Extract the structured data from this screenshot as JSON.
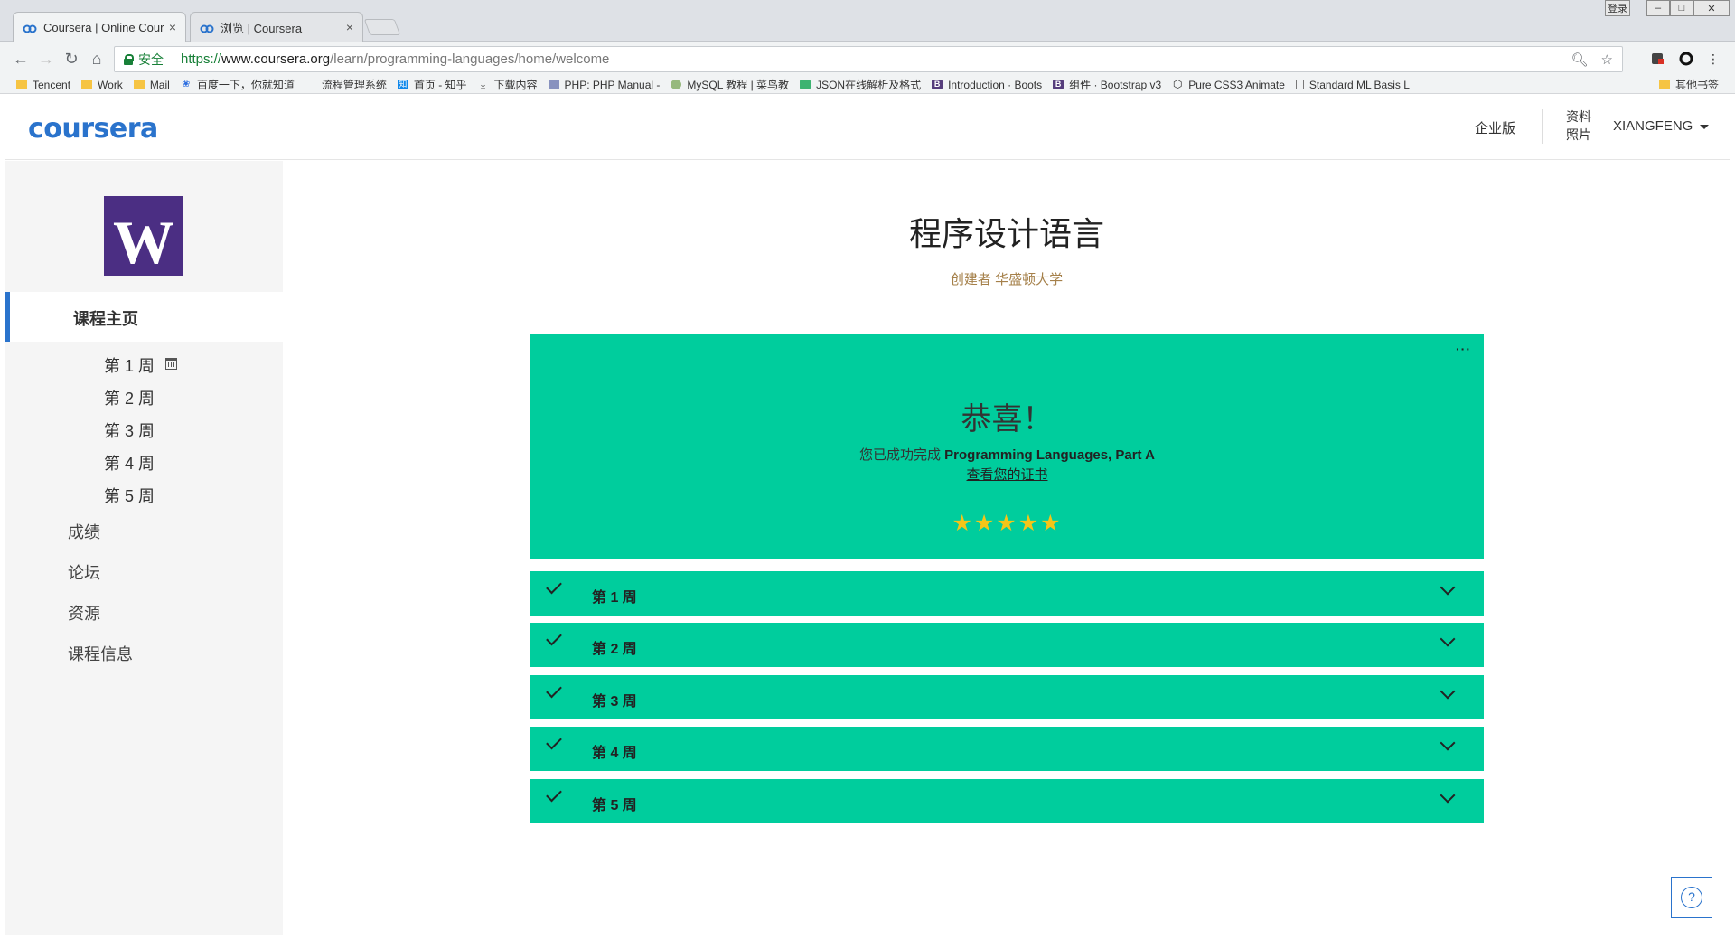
{
  "browser": {
    "tabs": [
      {
        "title": "Coursera | Online Cour",
        "close": "×"
      },
      {
        "title": "浏览 | Coursera",
        "close": "×"
      }
    ],
    "window_controls": [
      "登录",
      "–",
      "□",
      "✕"
    ],
    "nav": {
      "back": "←",
      "forward": "→",
      "reload": "↻",
      "home": "⌂"
    },
    "secure_label": "安全",
    "url": {
      "scheme": "https://",
      "host": "www.coursera.org",
      "path": "/learn/programming-languages/home/welcome"
    },
    "omnibox_icons": [
      "zoom-icon",
      "star-icon"
    ],
    "bookmarks": [
      {
        "label": "Tencent",
        "icon": "folder"
      },
      {
        "label": "Work",
        "icon": "folder"
      },
      {
        "label": "Mail",
        "icon": "folder"
      },
      {
        "label": "百度一下，你就知道",
        "icon": "baidu"
      },
      {
        "label": "流程管理系统",
        "icon": "none"
      },
      {
        "label": "首页 - 知乎",
        "icon": "zhihu"
      },
      {
        "label": "下载内容",
        "icon": "download"
      },
      {
        "label": "PHP: PHP Manual -",
        "icon": "php"
      },
      {
        "label": "MySQL 教程 | 菜鸟教",
        "icon": "runoob"
      },
      {
        "label": "JSON在线解析及格式",
        "icon": "json"
      },
      {
        "label": "Introduction · Boots",
        "icon": "bootstrap"
      },
      {
        "label": "组件 · Bootstrap v3",
        "icon": "bootstrap"
      },
      {
        "label": "Pure CSS3 Animate",
        "icon": "codepen"
      },
      {
        "label": "Standard ML Basis L",
        "icon": "page"
      }
    ],
    "other_bookmarks": "其他书签"
  },
  "site": {
    "logo": "coursera",
    "enterprise": "企业版",
    "profile_line1": "资料",
    "profile_line2": "照片",
    "username": "XIANGFENG"
  },
  "sidebar": {
    "uw_logo_letter": "W",
    "home": "课程主页",
    "weeks": [
      "第 1 周",
      "第 2 周",
      "第 3 周",
      "第 4 周",
      "第 5 周"
    ],
    "links": [
      "成绩",
      "论坛",
      "资源",
      "课程信息"
    ]
  },
  "course": {
    "title": "程序设计语言",
    "creator": "创建者 华盛顿大学"
  },
  "congrats": {
    "menu": "···",
    "title": "恭喜！",
    "line_prefix": "您已成功完成",
    "course_name": "Programming Languages, Part A",
    "certificate_link": "查看您的证书",
    "stars": "★★★★★",
    "rating": 5
  },
  "week_rows": [
    "第 1 周",
    "第 2 周",
    "第 3 周",
    "第 4 周",
    "第 5 周"
  ],
  "help": "?",
  "colors": {
    "accent": "#2a73cc",
    "success_green": "#00cd9d",
    "uw_purple": "#4b2e83",
    "star": "#f5c518"
  }
}
